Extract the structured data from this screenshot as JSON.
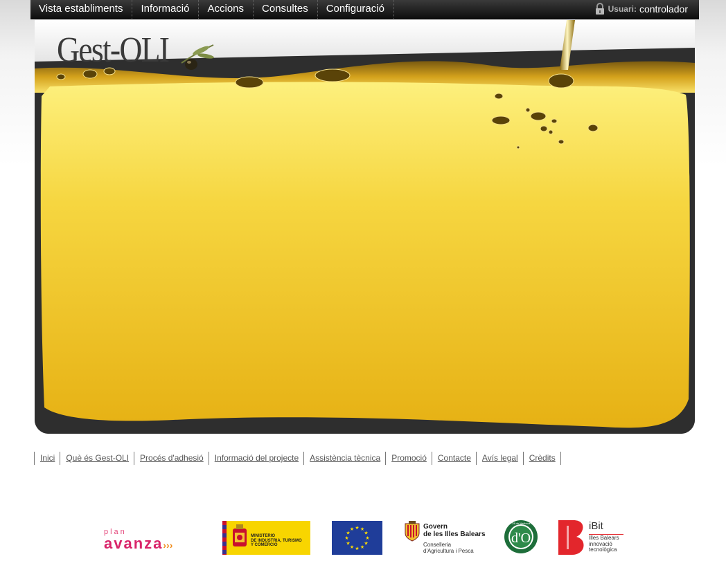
{
  "nav": {
    "items": [
      {
        "label": "Vista establiments"
      },
      {
        "label": "Informació"
      },
      {
        "label": "Accions"
      },
      {
        "label": "Consultes"
      },
      {
        "label": "Configuració"
      }
    ],
    "user_label": "Usuari:",
    "user_name": "controlador"
  },
  "banner": {
    "logo_text": "Gest-OLI"
  },
  "footer": {
    "links": [
      {
        "label": "Inici"
      },
      {
        "label": "Què és Gest-OLI"
      },
      {
        "label": "Procés d'adhesió"
      },
      {
        "label": "Informació del projecte"
      },
      {
        "label": "Assistència tècnica"
      },
      {
        "label": "Promoció"
      },
      {
        "label": "Contacte"
      },
      {
        "label": "Avís legal"
      },
      {
        "label": "Crèdits"
      }
    ]
  },
  "sponsors": {
    "plan_avanza": {
      "small": "plan",
      "big": "avanza",
      "arrows": "›››"
    },
    "ministerio": {
      "line1": "MINISTERIO",
      "line2": "DE INDUSTRIA, TURISMO",
      "line3": "Y COMERCIO"
    },
    "govern": {
      "line1": "Govern",
      "line2": "de les Illes Balears",
      "line3": "Conselleria",
      "line4": "d'Agricultura i Pesca"
    },
    "do": {
      "text": "d'O",
      "ring": "Oli de Mallorca"
    },
    "ibit": {
      "name": "iBit",
      "line1": "Illes Balears",
      "line2": "innovació",
      "line3": "tecnològica"
    }
  },
  "colors": {
    "oil_light": "#fbe56a",
    "oil_dark": "#e8b416",
    "banner_frame": "#2e2e2e",
    "nav_bg": "#1a1a1a"
  }
}
